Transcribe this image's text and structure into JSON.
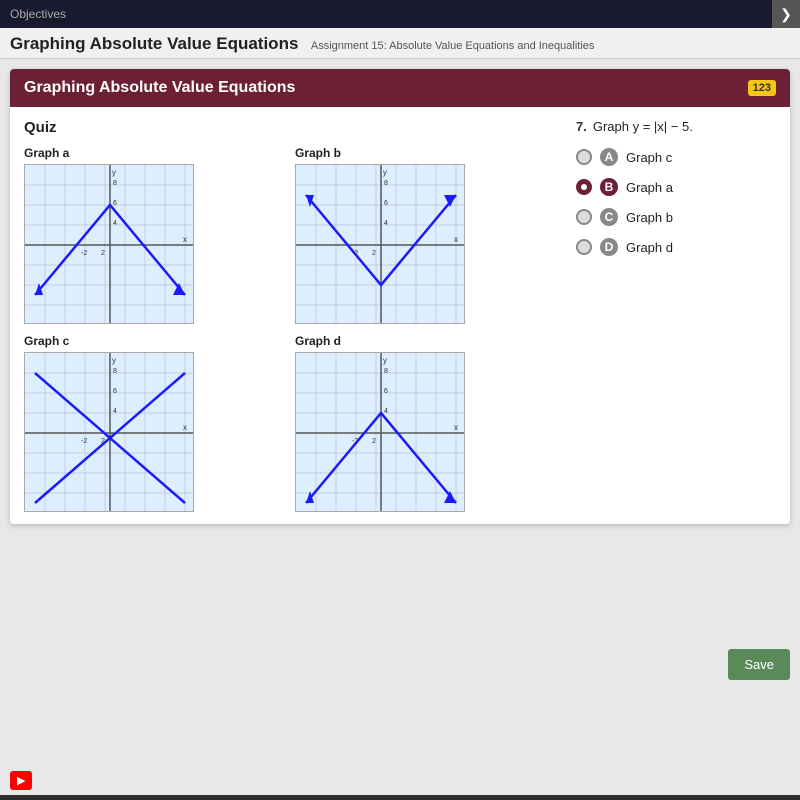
{
  "topBar": {
    "label": "Objectives",
    "arrowIcon": "❯"
  },
  "pageTitle": {
    "main": "Graphing Absolute Value Equations",
    "sub": "Assignment 15: Absolute Value Equations and Inequalities"
  },
  "card": {
    "header": "Graphing Absolute Value Equations",
    "badge": "123"
  },
  "quiz": {
    "label": "Quiz",
    "questionNumber": "7.",
    "questionText": "Graph y = |x| − 5."
  },
  "graphs": [
    {
      "id": "a",
      "label": "Graph a",
      "type": "V_up_high"
    },
    {
      "id": "b",
      "label": "Graph b",
      "type": "V_up_mid"
    },
    {
      "id": "c",
      "label": "Graph c",
      "type": "X_shape"
    },
    {
      "id": "d",
      "label": "Graph d",
      "type": "V_down"
    }
  ],
  "options": [
    {
      "letter": "A",
      "text": "Graph c",
      "selected": false
    },
    {
      "letter": "B",
      "text": "Graph a",
      "selected": true
    },
    {
      "letter": "C",
      "text": "Graph b",
      "selected": false
    },
    {
      "letter": "D",
      "text": "Graph d",
      "selected": false
    }
  ],
  "saveButton": "Save",
  "colors": {
    "accent": "#6b2035",
    "selectedOption": "#6b2035"
  }
}
